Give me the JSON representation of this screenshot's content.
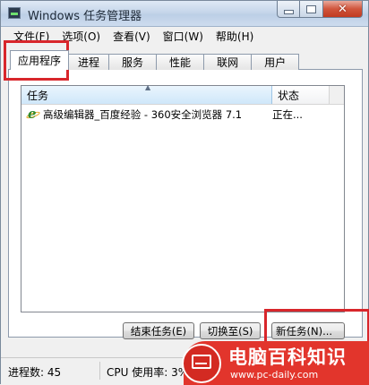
{
  "window": {
    "title": "Windows 任务管理器",
    "buttons": {
      "minimize": "minimize",
      "maximize": "maximize",
      "close": "✕"
    }
  },
  "menu": [
    "文件(F)",
    "选项(O)",
    "查看(V)",
    "窗口(W)",
    "帮助(H)"
  ],
  "tabs": [
    "应用程序",
    "进程",
    "服务",
    "性能",
    "联网",
    "用户"
  ],
  "active_tab": "应用程序",
  "list": {
    "columns": {
      "task": "任务",
      "status": "状态"
    },
    "sort_indicator": "▲",
    "rows": [
      {
        "task": "高级编辑器_百度经验 - 360安全浏览器 7.1",
        "status": "正在..."
      }
    ]
  },
  "buttons": {
    "end_task": "结束任务(E)",
    "switch_to": "切换至(S)",
    "new_task": "新任务(N)..."
  },
  "statusbar": {
    "processes": "进程数: 45",
    "cpu": "CPU 使用率: 3%"
  },
  "watermark": {
    "title": "电脑百科知识",
    "url": "www.pc-daily.com"
  },
  "colors": {
    "highlight": "#d8262b",
    "watermark_bg": "#e2352c"
  }
}
